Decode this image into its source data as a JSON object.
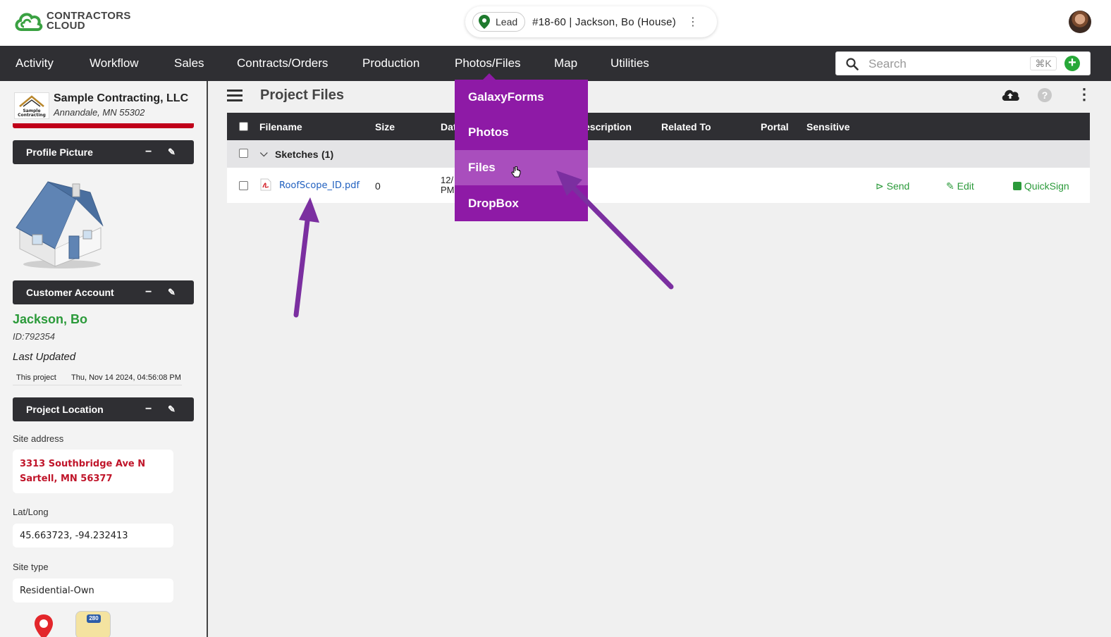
{
  "header": {
    "brand_line1": "CONTRACTORS",
    "brand_line2": "CLOUD",
    "lead_status": "Lead",
    "project_title": "#18-60 | Jackson, Bo (House)"
  },
  "nav": {
    "items": [
      "Activity",
      "Workflow",
      "Sales",
      "Contracts/Orders",
      "Production",
      "Photos/Files",
      "Map",
      "Utilities"
    ],
    "active": "Photos/Files",
    "search_placeholder": "Search",
    "search_shortcut": "⌘K"
  },
  "dropdown": {
    "items": [
      "GalaxyForms",
      "Photos",
      "Files",
      "DropBox"
    ],
    "hovered": "Files"
  },
  "sidebar": {
    "company_name": "Sample Contracting, LLC",
    "company_address": "Annandale, MN 55302",
    "company_logo_text": "Sample Contracting",
    "panels": {
      "profile_picture": "Profile Picture",
      "customer_account": "Customer Account",
      "project_location": "Project Location"
    },
    "customer_name": "Jackson, Bo",
    "customer_id": "ID:792354",
    "last_updated_label": "Last Updated",
    "last_updated_key": "This project",
    "last_updated_value": "Thu, Nov 14 2024, 04:56:08 PM",
    "site_address_label": "Site address",
    "site_address_line1": "3313 Southbridge Ave N",
    "site_address_line2": "Sartell, MN 56377",
    "latlong_label": "Lat/Long",
    "latlong_value": "45.663723, -94.232413",
    "site_type_label": "Site type",
    "site_type_value": "Residential-Own",
    "map_badge": "280"
  },
  "main": {
    "title": "Project Files",
    "columns": {
      "filename": "Filename",
      "size": "Size",
      "date": "Dat",
      "description": "escription",
      "related_to": "Related To",
      "portal": "Portal",
      "sensitive": "Sensitive"
    },
    "group": {
      "name": "Sketches",
      "count": "(1)"
    },
    "file": {
      "name": "RoofScope_ID.pdf",
      "size": "0",
      "date_line1": "12/",
      "date_line2": "PM"
    },
    "actions": {
      "send": "Send",
      "edit": "Edit",
      "quicksign": "QuickSign"
    }
  },
  "colors": {
    "nav_bg": "#2f2f33",
    "dropdown_bg": "#8e1aa6",
    "dropdown_hover": "#a94ebd",
    "accent_green": "#2b9a3a",
    "address_red": "#c0152a",
    "arrow_purple": "#7b2fa0"
  }
}
